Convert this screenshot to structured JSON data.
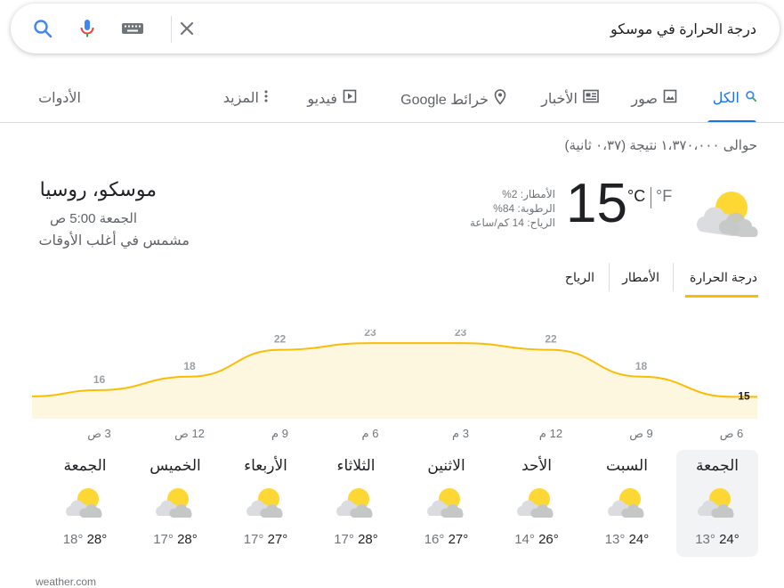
{
  "search": {
    "query": "درجة الحرارة في موسكو"
  },
  "tabs": [
    {
      "label": "الكل",
      "icon": "search-icon",
      "active": true
    },
    {
      "label": "صور",
      "icon": "image-icon"
    },
    {
      "label": "الأخبار",
      "icon": "news-icon"
    },
    {
      "label": "خرائط Google",
      "icon": "map-pin-icon"
    },
    {
      "label": "فيديو",
      "icon": "video-icon"
    },
    {
      "label": "المزيد",
      "icon": "more-vert-icon"
    }
  ],
  "tools_label": "الأدوات",
  "result_stats": "حوالى ١،٣٧٠،٠٠٠ نتيجة (٠،٣٧ ثانية)",
  "weather": {
    "location": "موسكو، روسيا",
    "day_time": "الجمعة 5:00 ص",
    "condition": "مشمس في أغلب الأوقات",
    "temperature": "15",
    "unit_c": "°C",
    "unit_f": "°F",
    "precipitation": "الأمطار: 2%",
    "humidity": "الرطوبة: 84%",
    "wind": "الرياح: 14 كم/ساعة",
    "subtabs": [
      "درجة الحرارة",
      "الأمطار",
      "الرياح"
    ],
    "chart_data": {
      "type": "area",
      "x": [
        "6 ص",
        "9 ص",
        "12 م",
        "3 م",
        "6 م",
        "9 م",
        "12 ص",
        "3 ص"
      ],
      "values": [
        15,
        18,
        22,
        23,
        23,
        22,
        18,
        16
      ],
      "accent": "#fbbc04",
      "fill": "#fef7e0"
    },
    "days": [
      {
        "name": "الجمعة",
        "high": "24°",
        "low": "13°",
        "icon": "partly-cloudy-icon",
        "selected": true
      },
      {
        "name": "السبت",
        "high": "24°",
        "low": "13°",
        "icon": "partly-cloudy-icon"
      },
      {
        "name": "الأحد",
        "high": "26°",
        "low": "14°",
        "icon": "partly-cloudy-icon"
      },
      {
        "name": "الاثنين",
        "high": "27°",
        "low": "16°",
        "icon": "partly-cloudy-icon"
      },
      {
        "name": "الثلاثاء",
        "high": "28°",
        "low": "17°",
        "icon": "partly-cloudy-icon"
      },
      {
        "name": "الأربعاء",
        "high": "27°",
        "low": "17°",
        "icon": "partly-cloudy-icon"
      },
      {
        "name": "الخميس",
        "high": "28°",
        "low": "17°",
        "icon": "partly-cloudy-icon"
      },
      {
        "name": "الجمعة",
        "high": "28°",
        "low": "18°",
        "icon": "partly-cloudy-icon"
      }
    ],
    "source": "weather.com"
  }
}
